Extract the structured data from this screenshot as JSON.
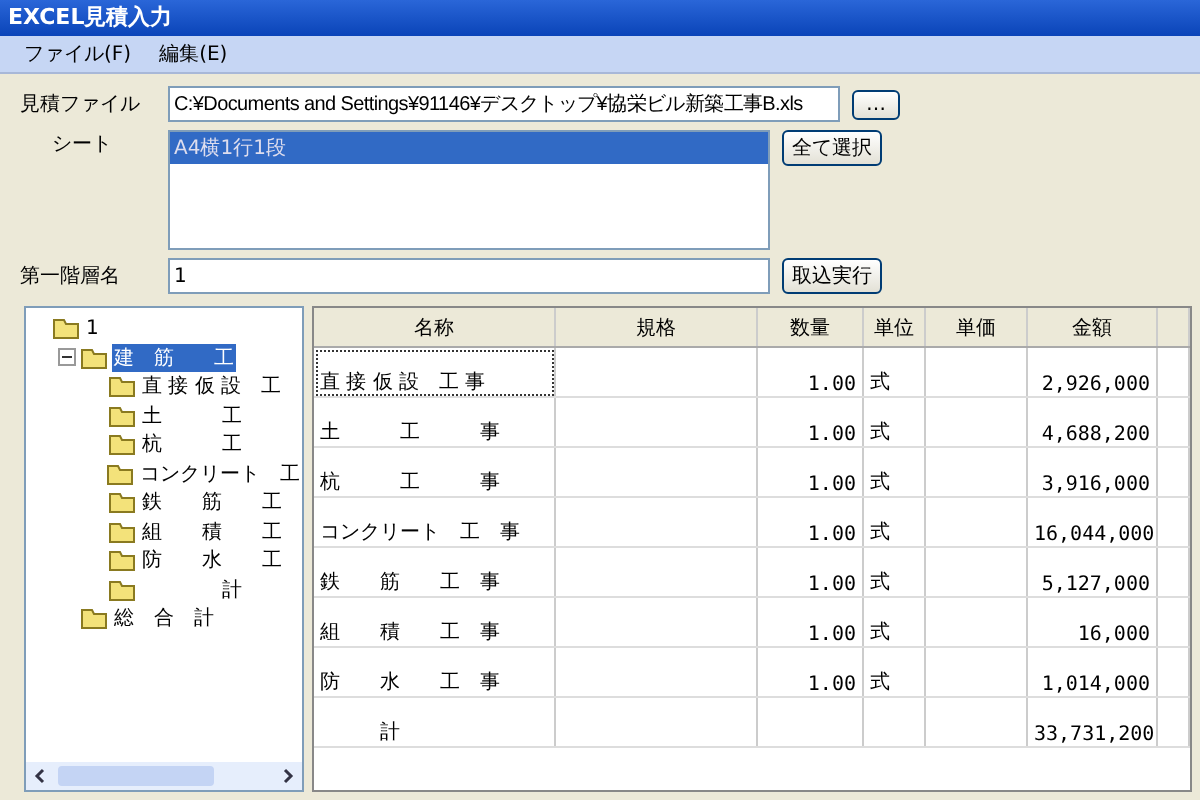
{
  "window": {
    "title": "EXCEL見積入力"
  },
  "menu": [
    "ファイル(F)",
    "編集(E)"
  ],
  "form": {
    "file_label": "見積ファイル",
    "file_value": "C:¥Documents and Settings¥91146¥デスクトップ¥協栄ビル新築工事B.xls",
    "browse_button": "…",
    "sheet_label": "シート",
    "sheets": [
      {
        "label": "A4横1行1段",
        "selected": true
      }
    ],
    "select_all_button": "全て選択",
    "level_label": "第一階層名",
    "level_value": "1",
    "import_button": "取込実行"
  },
  "tree": [
    {
      "label": "1",
      "selected": false,
      "children": [
        {
          "label": "建　筋　　工",
          "expanded": true,
          "selected": true,
          "children": [
            {
              "label": "直 接 仮 設　工",
              "selected": false
            },
            {
              "label": "土　　　工",
              "selected": false
            },
            {
              "label": "杭　　　工",
              "selected": false
            },
            {
              "label": "コンクリート　工",
              "selected": false
            },
            {
              "label": "鉄　　筋　　工",
              "selected": false
            },
            {
              "label": "組　　積　　工",
              "selected": false
            },
            {
              "label": "防　　水　　工",
              "selected": false
            },
            {
              "label": "　　　　計",
              "selected": false
            }
          ]
        },
        {
          "label": "総　合　計",
          "selected": false
        }
      ]
    }
  ],
  "table": {
    "columns": [
      "名称",
      "規格",
      "数量",
      "単位",
      "単価",
      "金額"
    ],
    "rows": [
      {
        "name": "直 接 仮 設　工 事",
        "spec": "",
        "qty": "1.00",
        "unit": "式",
        "price": "",
        "amount": "2,926,000",
        "selected": true
      },
      {
        "name": "土　　　工　　　事",
        "spec": "",
        "qty": "1.00",
        "unit": "式",
        "price": "",
        "amount": "4,688,200",
        "selected": false
      },
      {
        "name": "杭　　　工　　　事",
        "spec": "",
        "qty": "1.00",
        "unit": "式",
        "price": "",
        "amount": "3,916,000",
        "selected": false
      },
      {
        "name": "コンクリート　工　事",
        "spec": "",
        "qty": "1.00",
        "unit": "式",
        "price": "",
        "amount": "16,044,000",
        "selected": false
      },
      {
        "name": "鉄　　筋　　工　事",
        "spec": "",
        "qty": "1.00",
        "unit": "式",
        "price": "",
        "amount": "5,127,000",
        "selected": false
      },
      {
        "name": "組　　積　　工　事",
        "spec": "",
        "qty": "1.00",
        "unit": "式",
        "price": "",
        "amount": "16,000",
        "selected": false
      },
      {
        "name": "防　　水　　工　事",
        "spec": "",
        "qty": "1.00",
        "unit": "式",
        "price": "",
        "amount": "1,014,000",
        "selected": false
      },
      {
        "name": "　　　計",
        "spec": "",
        "qty": "",
        "unit": "",
        "price": "",
        "amount": "33,731,200",
        "selected": false
      }
    ]
  }
}
